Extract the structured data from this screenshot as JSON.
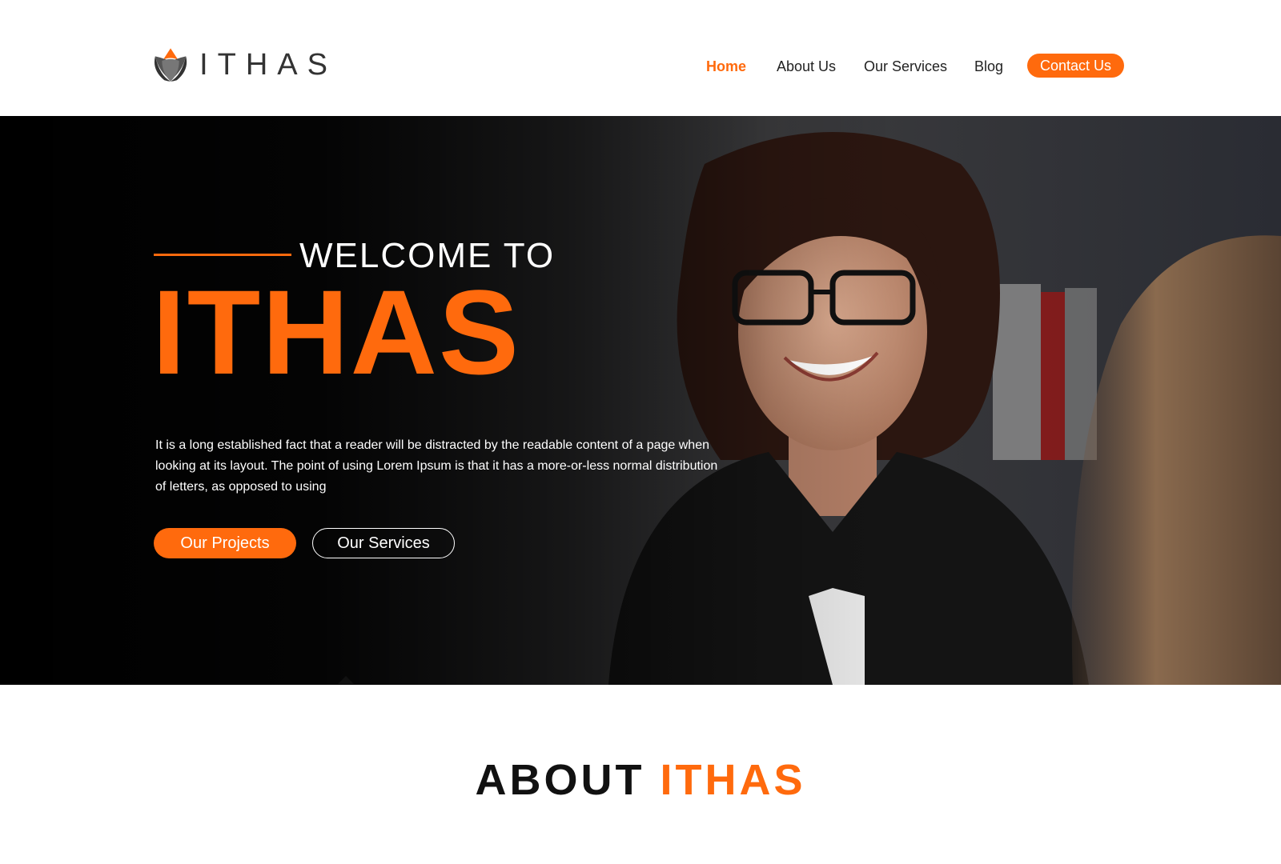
{
  "brand": {
    "name": "ITHAS",
    "accent_color": "#ff6a0d"
  },
  "nav": {
    "items": [
      {
        "label": "Home",
        "active": true
      },
      {
        "label": "About Us",
        "active": false
      },
      {
        "label": "Our Services",
        "active": false
      },
      {
        "label": "Blog",
        "active": false
      }
    ],
    "cta_label": "Contact Us"
  },
  "hero": {
    "welcome": "WELCOME TO",
    "title": "ITHAS",
    "description": "It is a long established fact that a reader will be distracted by the readable content of a page when looking at its layout. The point of using Lorem Ipsum is that it has a more-or-less normal distribution of letters, as opposed to using",
    "primary_button": "Our Projects",
    "secondary_button": "Our Services"
  },
  "about": {
    "title_prefix": "ABOUT",
    "title_accent": "ITHAS"
  }
}
